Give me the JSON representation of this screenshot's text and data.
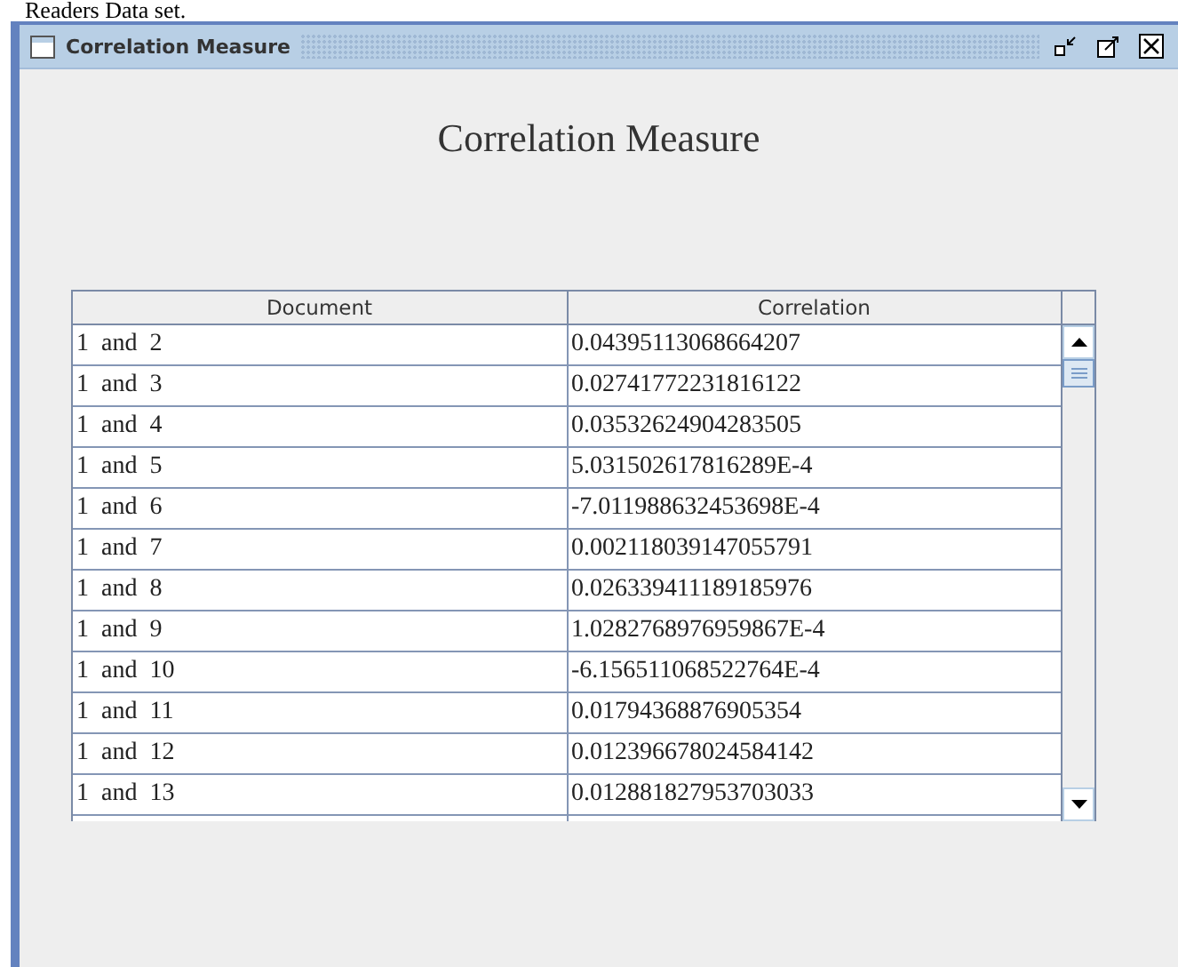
{
  "document_text": "Readers Data set.",
  "window": {
    "title": "Correlation Measure",
    "heading": "Correlation Measure"
  },
  "table": {
    "columns": [
      "Document",
      "Correlation"
    ],
    "rows": [
      [
        "1  and  2",
        "0.04395113068664207"
      ],
      [
        "1  and  3",
        "0.02741772231816122"
      ],
      [
        "1  and  4",
        "0.03532624904283505"
      ],
      [
        "1  and  5",
        "5.031502617816289E-4"
      ],
      [
        "1  and  6",
        "-7.011988632453698E-4"
      ],
      [
        "1  and  7",
        "0.002118039147055791"
      ],
      [
        "1  and  8",
        "0.026339411189185976"
      ],
      [
        "1  and  9",
        "1.0282768976959867E-4"
      ],
      [
        "1  and  10",
        "-6.156511068522764E-4"
      ],
      [
        "1  and  11",
        "0.01794368876905354"
      ],
      [
        "1  and  12",
        "0.012396678024584142"
      ],
      [
        "1  and  13",
        "0.012881827953703033"
      ]
    ]
  }
}
